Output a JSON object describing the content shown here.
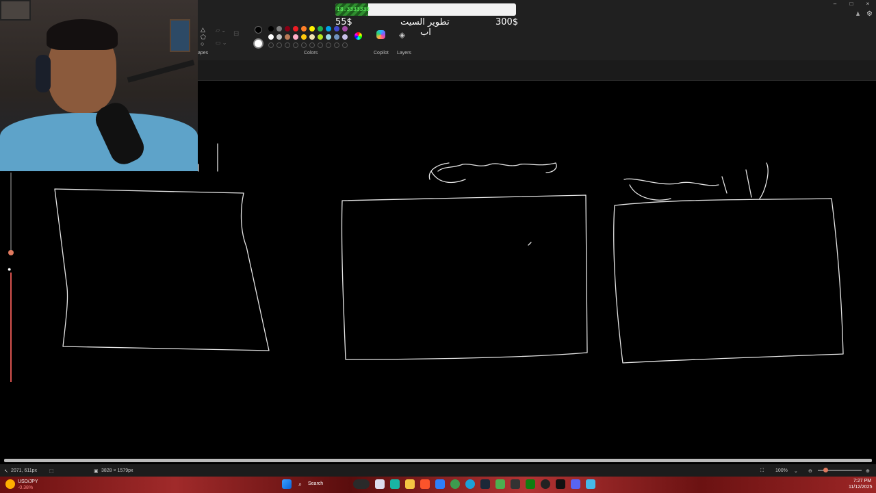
{
  "ribbon": {
    "groups": {
      "shapes": "apes",
      "colors": "Colors",
      "copilot": "Copilot",
      "layers": "Layers"
    },
    "window_buttons": [
      "–",
      "□",
      "×"
    ]
  },
  "colors": {
    "primary": "#000000",
    "secondary": "#ffffff",
    "row1": [
      "#000000",
      "#7f7f7f",
      "#880015",
      "#ed1c24",
      "#ff7f27",
      "#fff200",
      "#22b14c",
      "#00a2e8",
      "#3f48cc",
      "#a349a4"
    ],
    "row2": [
      "#ffffff",
      "#c3c3c3",
      "#b97a57",
      "#ffaec9",
      "#ffc90e",
      "#efe4b0",
      "#b5e61d",
      "#99d9ea",
      "#7092be",
      "#c8bfe7"
    ]
  },
  "overlay": {
    "progress_label": "18.3333333",
    "progress_fraction": 0.183,
    "goal_current": "55$",
    "goal_title_line1": "تطوير السيت",
    "goal_title_line2": "اب",
    "goal_target": "300$"
  },
  "canvas": {
    "handwritten": [
      "جسم",
      "لابس"
    ]
  },
  "statusbar": {
    "cursor_pos": "2071, 611px",
    "canvas_size": "3828 × 1579px",
    "zoom": "100%"
  },
  "taskbar": {
    "ticker_name": "USD/JPY",
    "ticker_value": "-0.38%",
    "search_placeholder": "Search",
    "time": "7:27 PM",
    "date": "11/12/2025"
  }
}
